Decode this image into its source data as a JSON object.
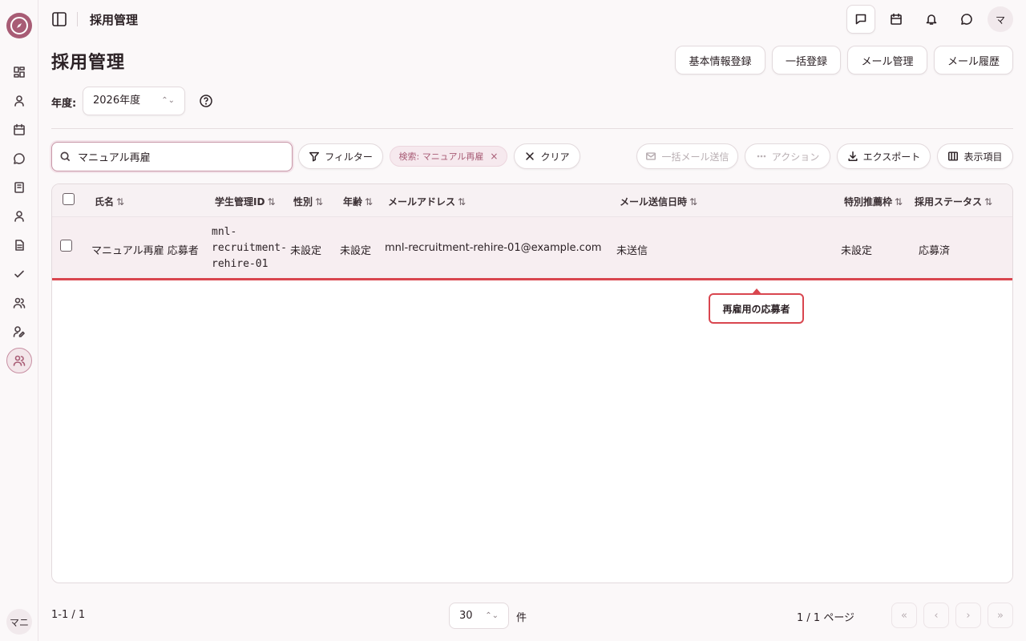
{
  "app": {
    "section_title": "採用管理",
    "user_initial_top": "マ",
    "user_initial_sidebar": "マニ"
  },
  "colors": {
    "accent": "#a85c75",
    "highlight": "#d9464f"
  },
  "sidebar": {
    "items": [
      {
        "icon": "dashboard-icon"
      },
      {
        "icon": "user-icon"
      },
      {
        "icon": "calendar-icon"
      },
      {
        "icon": "chat-icon"
      },
      {
        "icon": "notebook-icon"
      },
      {
        "icon": "user-icon"
      },
      {
        "icon": "document-icon"
      },
      {
        "icon": "check-icon"
      },
      {
        "icon": "users-icon"
      },
      {
        "icon": "user-edit-icon"
      },
      {
        "icon": "users-icon"
      }
    ],
    "active_index": 10
  },
  "topbar": {
    "icons": [
      "message-square-icon",
      "calendar-icon",
      "bell-icon",
      "chat-icon"
    ]
  },
  "page": {
    "title": "採用管理",
    "buttons": [
      "基本情報登録",
      "一括登録",
      "メール管理",
      "メール履歴"
    ],
    "year_label": "年度:",
    "year_value": "2026年度"
  },
  "toolbar": {
    "search_value": "マニュアル再雇",
    "filter_label": "フィルター",
    "chip_label": "検索: マニュアル再雇",
    "chip_close": "×",
    "clear_label": "クリア",
    "bulk_mail_label": "一括メール送信",
    "action_label": "アクション",
    "export_label": "エクスポート",
    "columns_label": "表示項目"
  },
  "table": {
    "columns": [
      "氏名",
      "学生管理ID",
      "性別",
      "年齢",
      "メールアドレス",
      "メール送信日時",
      "特別推薦枠",
      "採用ステータス"
    ],
    "sort_glyph": "⇅",
    "rows": [
      {
        "name": "マニュアル再雇 応募者",
        "student_id": "mnl-recruitment-rehire-01",
        "gender": "未設定",
        "age": "未設定",
        "email": "mnl-recruitment-rehire-01@example.com",
        "mail_sent": "未送信",
        "special": "未設定",
        "status": "応募済"
      }
    ]
  },
  "tooltip": "再雇用の応募者",
  "footer": {
    "range": "1-1 / 1",
    "per_page": "30",
    "per_page_unit": "件",
    "page_info": "1 / 1 ページ",
    "nav": [
      "«",
      "‹",
      "›",
      "»"
    ]
  }
}
